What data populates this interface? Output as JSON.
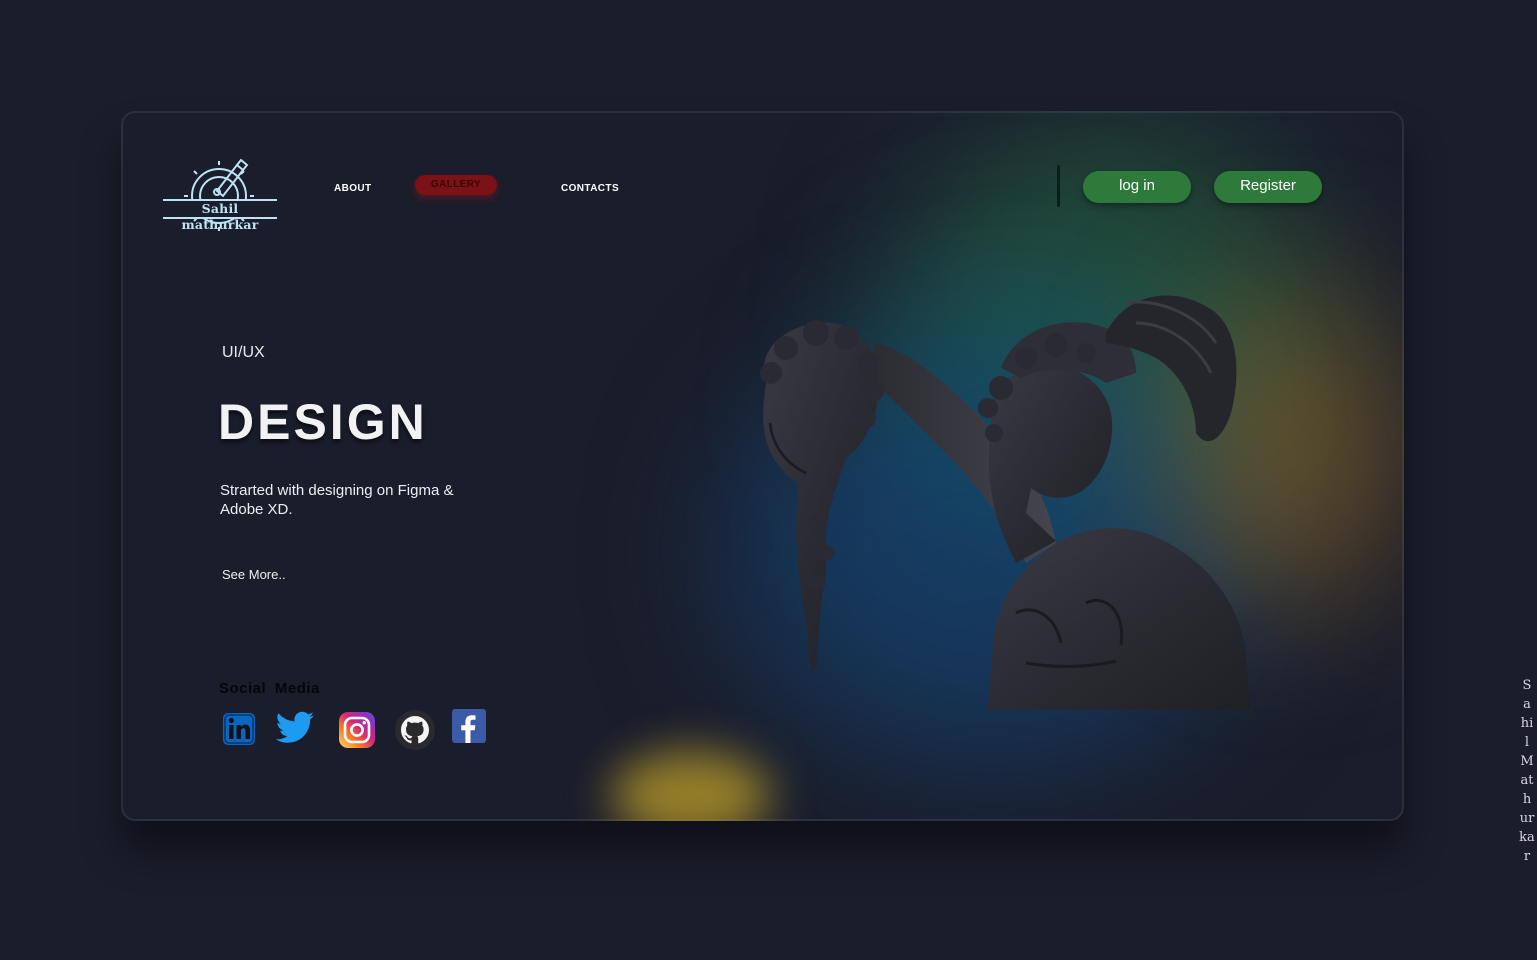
{
  "brand": {
    "logo_text": "Sahil mathurkar"
  },
  "nav": {
    "items": [
      {
        "label": "ABOUT",
        "active": false
      },
      {
        "label": "GALLERY",
        "active": true
      },
      {
        "label": "CONTACTS",
        "active": false
      }
    ]
  },
  "auth": {
    "login_label": "log in",
    "register_label": "Register"
  },
  "hero": {
    "eyebrow": "UI/UX",
    "headline": "DESIGN",
    "description": "Strarted with designing on Figma & Adobe XD.",
    "see_more": "See More.."
  },
  "social": {
    "title": "Social  Media",
    "icons": [
      "linkedin-icon",
      "twitter-icon",
      "instagram-icon",
      "github-icon",
      "facebook-icon"
    ]
  },
  "side_text": "Sahil Mathurkar",
  "colors": {
    "background": "#1b1d2b",
    "button_green": "#2e7a3a",
    "gallery_red": "#7a1218",
    "logo_blue": "#bfe3f5"
  }
}
